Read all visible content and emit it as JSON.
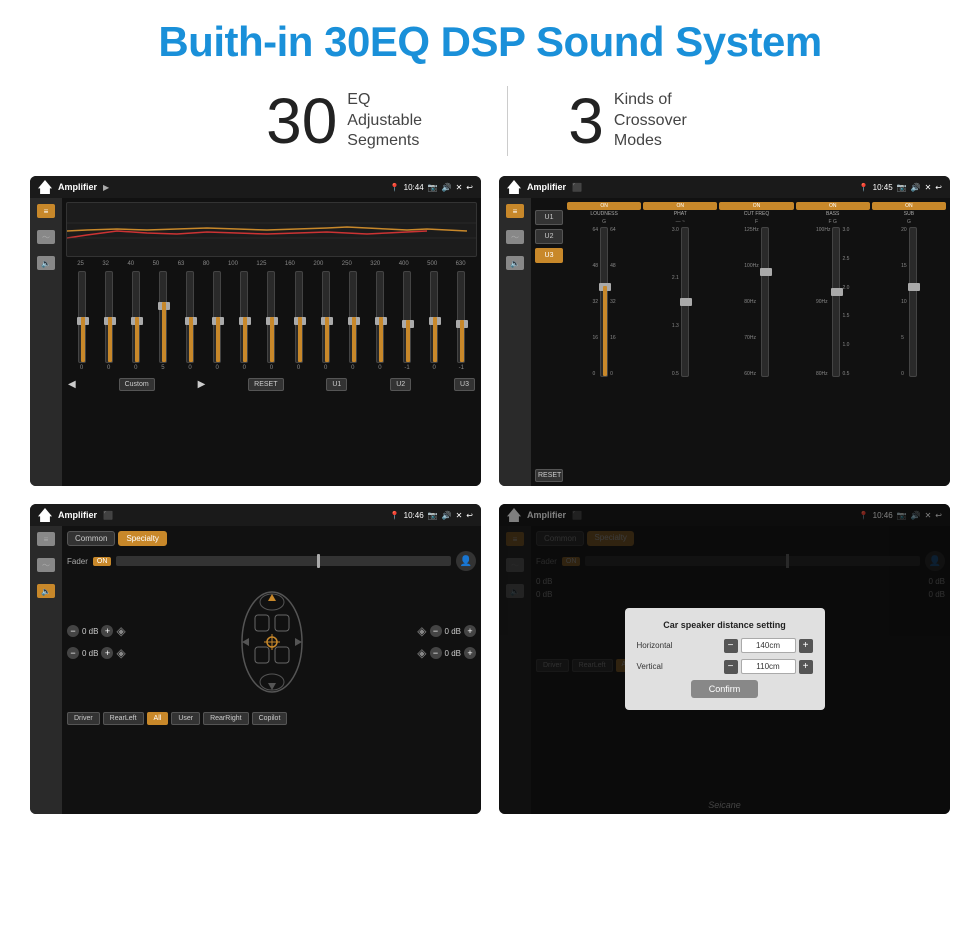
{
  "header": {
    "title": "Buith-in 30EQ DSP Sound System"
  },
  "stats": [
    {
      "number": "30",
      "label": "EQ Adjustable\nSegments"
    },
    {
      "number": "3",
      "label": "Kinds of\nCrossover Modes"
    }
  ],
  "screens": [
    {
      "id": "screen-eq",
      "title": "Amplifier",
      "time": "10:44",
      "description": "EQ Equalizer screen"
    },
    {
      "id": "screen-crossover",
      "title": "Amplifier",
      "time": "10:45",
      "description": "Crossover screen"
    },
    {
      "id": "screen-specialty",
      "title": "Amplifier",
      "time": "10:46",
      "description": "Specialty/Fader screen"
    },
    {
      "id": "screen-distance",
      "title": "Amplifier",
      "time": "10:46",
      "description": "Distance setting dialog"
    }
  ],
  "eq": {
    "bands": [
      "25",
      "32",
      "40",
      "50",
      "63",
      "80",
      "100",
      "125",
      "160",
      "200",
      "250",
      "320",
      "400",
      "500",
      "630"
    ],
    "values": [
      "0",
      "0",
      "0",
      "5",
      "0",
      "0",
      "0",
      "0",
      "0",
      "0",
      "0",
      "0",
      "-1",
      "0",
      "-1"
    ],
    "presets": [
      "Custom",
      "RESET",
      "U1",
      "U2",
      "U3"
    ]
  },
  "crossover": {
    "channels": [
      "LOUDNESS",
      "PHAT",
      "CUT FREQ",
      "BASS",
      "SUB"
    ],
    "presets": [
      "U1",
      "U2",
      "U3"
    ]
  },
  "specialty": {
    "tabs": [
      "Common",
      "Specialty"
    ],
    "fader_label": "Fader",
    "fader_toggle": "ON",
    "seats": [
      "Driver",
      "RearLeft",
      "All",
      "User",
      "RearRight",
      "Copilot"
    ],
    "db_values": [
      "0 dB",
      "0 dB",
      "0 dB",
      "0 dB"
    ]
  },
  "dialog": {
    "title": "Car speaker distance setting",
    "horizontal_label": "Horizontal",
    "horizontal_value": "140cm",
    "vertical_label": "Vertical",
    "vertical_value": "110cm",
    "confirm_label": "Confirm"
  },
  "watermark": "Seicane"
}
